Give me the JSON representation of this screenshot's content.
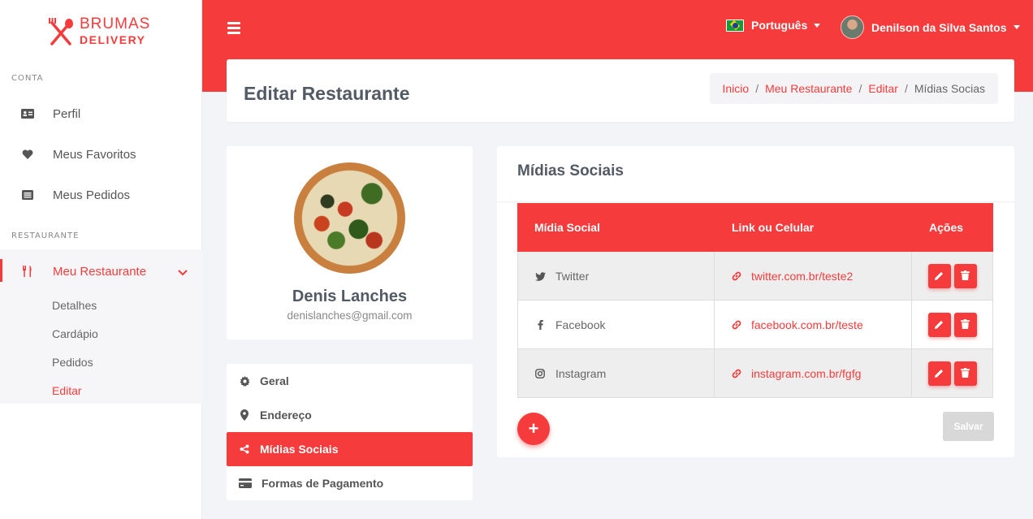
{
  "brand": {
    "line1": "BRUMAS",
    "line2": "DELIVERY",
    "color": "#f53b3b"
  },
  "sidebar": {
    "section_account": "CONTA",
    "account_items": [
      {
        "label": "Perfil",
        "icon": "id-card-icon"
      },
      {
        "label": "Meus Favoritos",
        "icon": "heart-icon"
      },
      {
        "label": "Meus Pedidos",
        "icon": "list-icon"
      }
    ],
    "section_restaurant": "RESTAURANTE",
    "restaurant_item": {
      "label": "Meu Restaurante",
      "icon": "utensils-icon"
    },
    "sub_items": [
      "Detalhes",
      "Cardápio",
      "Pedidos",
      "Editar"
    ],
    "active_sub": "Editar"
  },
  "topbar": {
    "language": "Português",
    "user_name": "Denilson da Silva Santos"
  },
  "header": {
    "title": "Editar Restaurante",
    "breadcrumb": [
      "Inicio",
      "Meu Restaurante",
      "Editar"
    ],
    "breadcrumb_current": "Mídias Socias"
  },
  "profile": {
    "name": "Denis Lanches",
    "email": "denislanches@gmail.com"
  },
  "settings_menu": [
    {
      "label": "Geral",
      "icon": "gear-icon"
    },
    {
      "label": "Endereço",
      "icon": "map-marker-icon"
    },
    {
      "label": "Mídias Sociais",
      "icon": "share-icon",
      "active": true
    },
    {
      "label": "Formas de Pagamento",
      "icon": "credit-card-icon"
    }
  ],
  "social": {
    "title": "Mídias Sociais",
    "columns": [
      "Mídia Social",
      "Link ou Celular",
      "Ações"
    ],
    "rows": [
      {
        "network": "Twitter",
        "icon": "twitter-icon",
        "link": "twitter.com.br/teste2"
      },
      {
        "network": "Facebook",
        "icon": "facebook-icon",
        "link": "facebook.com.br/teste"
      },
      {
        "network": "Instagram",
        "icon": "instagram-icon",
        "link": "instagram.com.br/fgfg"
      }
    ],
    "add_label": "+",
    "save_label": "Salvar"
  }
}
